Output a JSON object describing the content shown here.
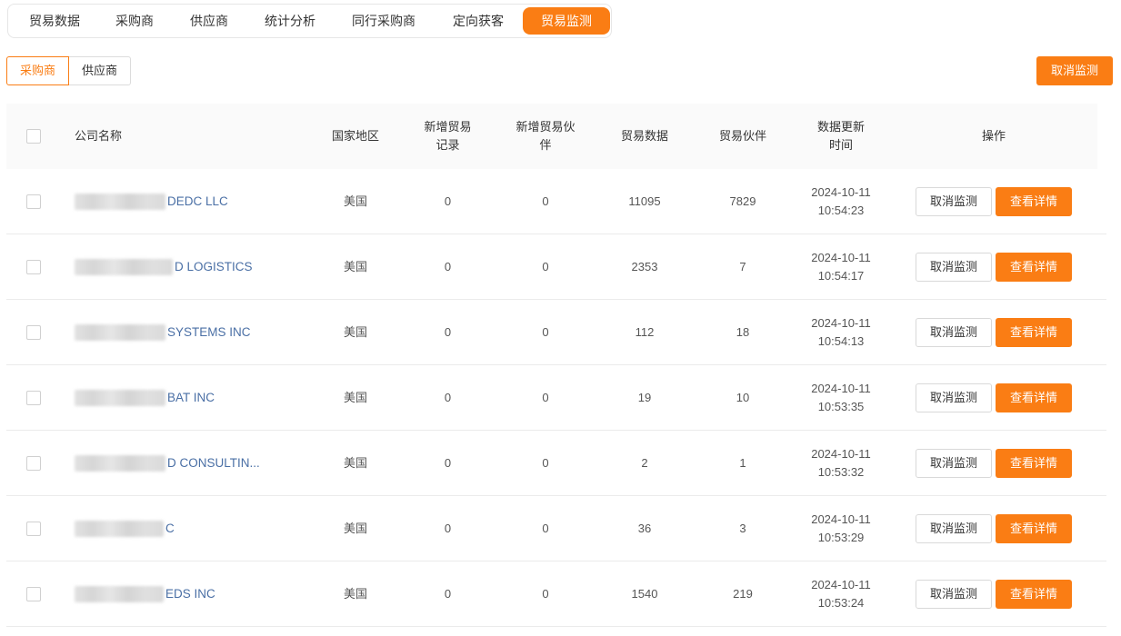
{
  "tabs": [
    {
      "label": "贸易数据",
      "active": false
    },
    {
      "label": "采购商",
      "active": false
    },
    {
      "label": "供应商",
      "active": false
    },
    {
      "label": "统计分析",
      "active": false
    },
    {
      "label": "同行采购商",
      "active": false
    },
    {
      "label": "定向获客",
      "active": false
    },
    {
      "label": "贸易监测",
      "active": true
    }
  ],
  "segment": {
    "buyer_label": "采购商",
    "supplier_label": "供应商",
    "active": "buyer"
  },
  "toolbar": {
    "cancel_monitor_label": "取消监测"
  },
  "table": {
    "headers": {
      "company": "公司名称",
      "region": "国家地区",
      "new_records": "新增贸易记录",
      "new_partners": "新增贸易伙伴",
      "trade_data": "贸易数据",
      "partners": "贸易伙伴",
      "updated": "数据更新时间",
      "ops": "操作"
    },
    "rows": [
      {
        "company_suffix": "DEDC LLC",
        "region": "美国",
        "new_records": "0",
        "new_partners": "0",
        "trade_data": "11095",
        "partners": "7829",
        "date": "2024-10-11",
        "time": "10:54:23"
      },
      {
        "company_suffix": "D LOGISTICS",
        "region": "美国",
        "new_records": "0",
        "new_partners": "0",
        "trade_data": "2353",
        "partners": "7",
        "date": "2024-10-11",
        "time": "10:54:17"
      },
      {
        "company_suffix": "SYSTEMS INC",
        "region": "美国",
        "new_records": "0",
        "new_partners": "0",
        "trade_data": "112",
        "partners": "18",
        "date": "2024-10-11",
        "time": "10:54:13"
      },
      {
        "company_suffix": "BAT INC",
        "region": "美国",
        "new_records": "0",
        "new_partners": "0",
        "trade_data": "19",
        "partners": "10",
        "date": "2024-10-11",
        "time": "10:53:35"
      },
      {
        "company_suffix": "D CONSULTIN...",
        "region": "美国",
        "new_records": "0",
        "new_partners": "0",
        "trade_data": "2",
        "partners": "1",
        "date": "2024-10-11",
        "time": "10:53:32"
      },
      {
        "company_suffix": "C",
        "region": "美国",
        "new_records": "0",
        "new_partners": "0",
        "trade_data": "36",
        "partners": "3",
        "date": "2024-10-11",
        "time": "10:53:29"
      },
      {
        "company_suffix": "EDS INC",
        "region": "美国",
        "new_records": "0",
        "new_partners": "0",
        "trade_data": "1540",
        "partners": "219",
        "date": "2024-10-11",
        "time": "10:53:24"
      }
    ],
    "row_ops": {
      "cancel_label": "取消监测",
      "detail_label": "查看详情"
    }
  },
  "colors": {
    "accent": "#fa7d14",
    "link": "#4a6fa5",
    "header_bg": "#fafafa"
  }
}
